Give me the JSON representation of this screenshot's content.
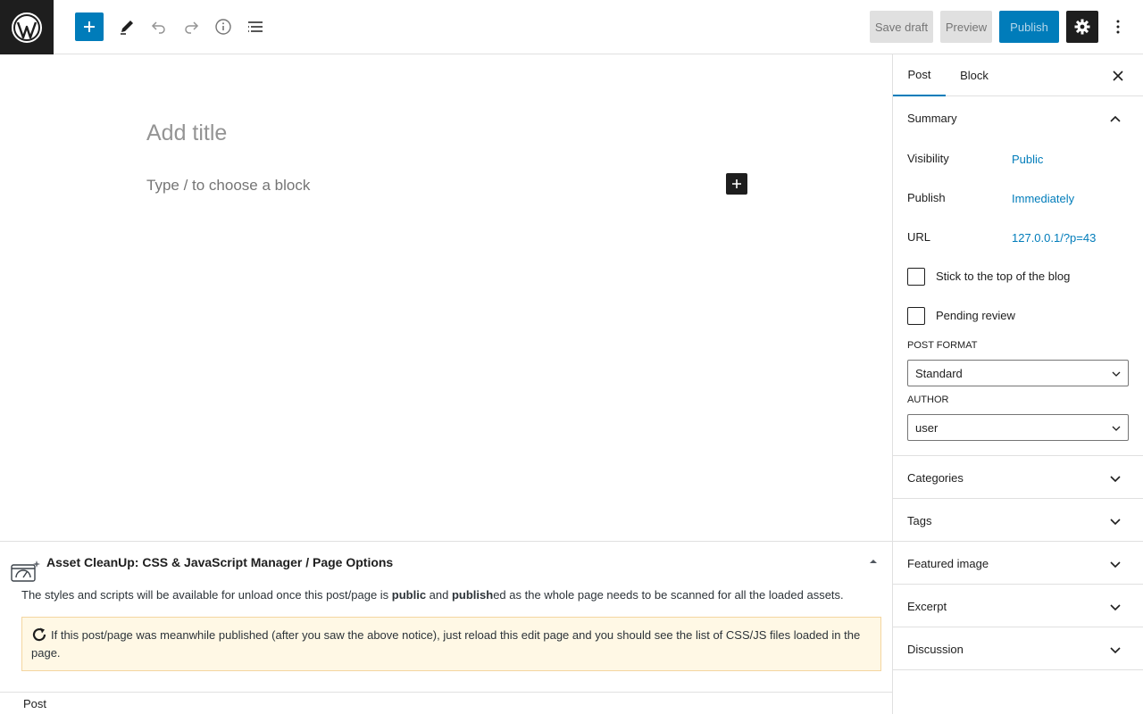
{
  "toolbar": {
    "logo_icon": "wordpress-logo-icon",
    "inserter_icon": "plus-icon",
    "tools_icon": "pencil-icon",
    "undo_icon": "undo-icon",
    "redo_icon": "redo-icon",
    "info_icon": "info-icon",
    "listview_icon": "list-view-icon",
    "save_draft": "Save draft",
    "preview": "Preview",
    "publish": "Publish",
    "settings_icon": "gear-icon",
    "more_icon": "vertical-ellipsis-icon"
  },
  "editor": {
    "title_placeholder": "Add title",
    "block_placeholder": "Type / to choose a block"
  },
  "metabox": {
    "title": "Asset CleanUp: CSS & JavaScript Manager / Page Options",
    "text_before": "The styles and scripts will be available for unload once this post/page is ",
    "text_bold1": "public",
    "text_mid": " and ",
    "text_bold2": "publish",
    "text_after": "ed as the whole page needs to be scanned for all the loaded assets.",
    "notice": "If this post/page was meanwhile published (after you saw the above notice), just reload this edit page and you should see the list of CSS/JS files loaded in the page."
  },
  "footer": {
    "breadcrumb": "Post"
  },
  "sidebar": {
    "tabs": [
      "Post",
      "Block"
    ],
    "summary": {
      "title": "Summary",
      "visibility_label": "Visibility",
      "visibility_value": "Public",
      "publish_label": "Publish",
      "publish_value": "Immediately",
      "url_label": "URL",
      "url_value": "127.0.0.1/?p=43",
      "sticky_label": "Stick to the top of the blog",
      "pending_label": "Pending review",
      "post_format_label": "POST FORMAT",
      "post_format_value": "Standard",
      "author_label": "AUTHOR",
      "author_value": "user"
    },
    "panels": [
      "Categories",
      "Tags",
      "Featured image",
      "Excerpt",
      "Discussion"
    ]
  },
  "colors": {
    "accent": "#007cba",
    "dark": "#1e1e1e",
    "notice_bg": "#fff8e5"
  }
}
